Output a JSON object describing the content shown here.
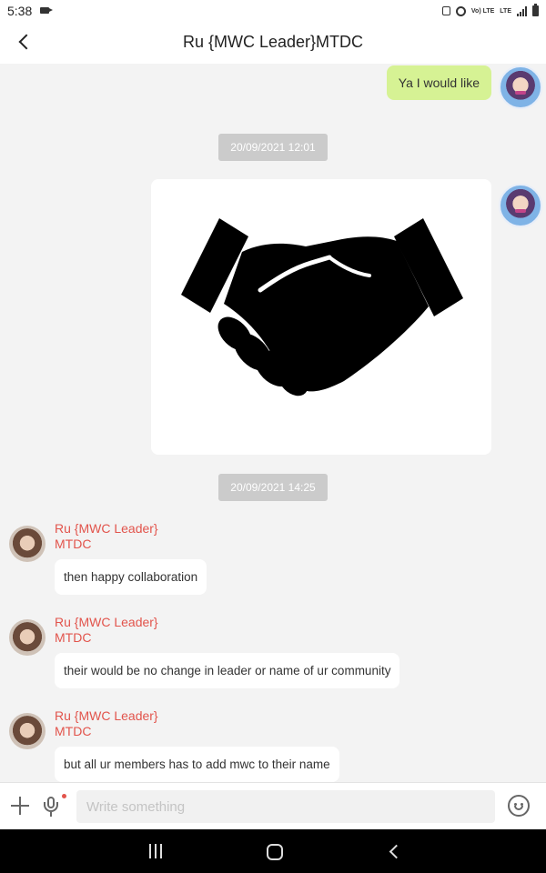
{
  "status_bar": {
    "time": "5:38",
    "icons": [
      "video-icon",
      "lock-icon",
      "alarm-icon",
      "volte-icon",
      "lte-icon",
      "signal-icon",
      "battery-icon"
    ],
    "volte_label": "Vo) LTE",
    "lte_label": "LTE"
  },
  "header": {
    "title": "Ru {MWC Leader}MTDC"
  },
  "chat": {
    "outgoing_text": "Ya I would like",
    "timestamps": [
      "20/09/2021 12:01",
      "20/09/2021 14:25"
    ],
    "image_description_icon": "handshake-icon",
    "messages": [
      {
        "sender_line1": "Ru {MWC Leader}",
        "sender_line2": "MTDC",
        "text": "then happy collaboration"
      },
      {
        "sender_line1": "Ru {MWC Leader}",
        "sender_line2": "MTDC",
        "text": "their would be no change in leader or name of ur community"
      },
      {
        "sender_line1": "Ru {MWC Leader}",
        "sender_line2": "MTDC",
        "text": "but all ur members has to add mwc to their name"
      }
    ]
  },
  "input_bar": {
    "placeholder": "Write something",
    "icons": [
      "plus-icon",
      "microphone-icon",
      "emoji-icon"
    ]
  },
  "nav_bar": {
    "icons": [
      "recents-icon",
      "home-icon",
      "back-icon"
    ]
  },
  "colors": {
    "outgoing_bubble": "#d6f294",
    "sender_name": "#e2544c",
    "timestamp_bg": "#cbcbcb",
    "chat_bg": "#f3f3f3"
  }
}
